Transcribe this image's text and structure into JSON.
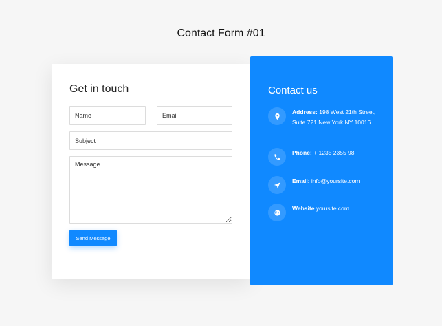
{
  "page": {
    "title": "Contact Form #01"
  },
  "form": {
    "heading": "Get in touch",
    "name_placeholder": "Name",
    "email_placeholder": "Email",
    "subject_placeholder": "Subject",
    "message_placeholder": "Message",
    "send_label": "Send Message"
  },
  "contact": {
    "heading": "Contact us",
    "items": [
      {
        "icon": "map-pin-icon",
        "label": "Address:",
        "value": "198 West 21th Street, Suite 721 New York NY 10016"
      },
      {
        "icon": "phone-icon",
        "label": "Phone:",
        "value": "+ 1235 2355 98"
      },
      {
        "icon": "paper-plane-icon",
        "label": "Email:",
        "value": "info@yoursite.com"
      },
      {
        "icon": "globe-icon",
        "label": "Website",
        "value": "yoursite.com"
      }
    ]
  },
  "colors": {
    "accent": "#1089ff",
    "background": "#f6f6f6",
    "card": "#ffffff"
  }
}
